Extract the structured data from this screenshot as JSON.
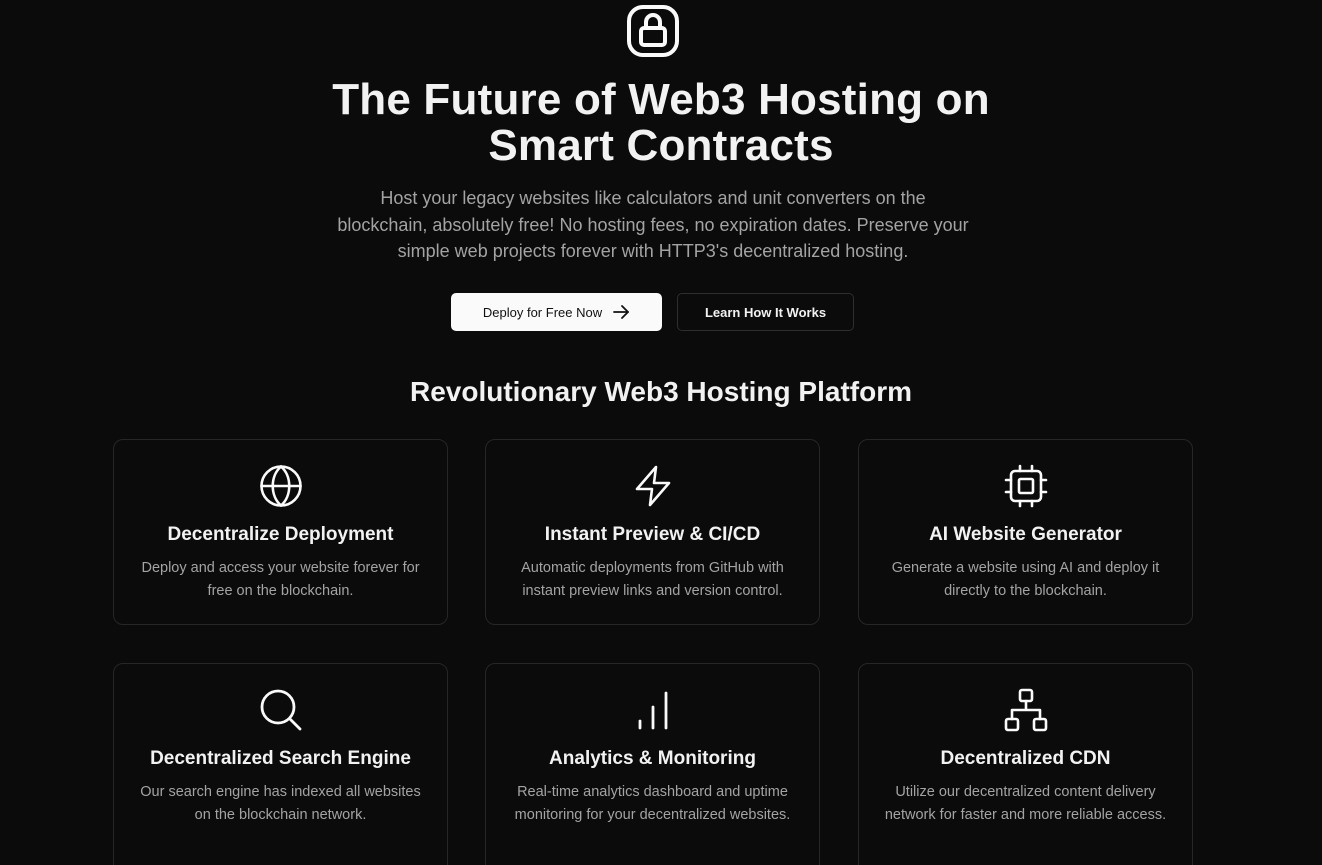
{
  "hero": {
    "icon": "lock-icon",
    "title_line1": "The Future of Web3 Hosting on",
    "title_line2": "Smart Contracts",
    "subtitle": "Host your legacy websites like calculators and unit converters on the blockchain, absolutely free! No hosting fees, no expiration dates. Preserve your simple web projects forever with HTTP3's decentralized hosting.",
    "primary_button": "Deploy for Free Now",
    "secondary_button": "Learn How It Works"
  },
  "features": {
    "section_title": "Revolutionary Web3 Hosting Platform",
    "items": [
      {
        "icon": "globe-icon",
        "title": "Decentralize Deployment",
        "description": "Deploy and access your website forever for free on the blockchain."
      },
      {
        "icon": "lightning-icon",
        "title": "Instant Preview & CI/CD",
        "description": "Automatic deployments from GitHub with instant preview links and version control."
      },
      {
        "icon": "cpu-chip-icon",
        "title": "AI Website Generator",
        "description": "Generate a website using AI and deploy it directly to the blockchain."
      },
      {
        "icon": "search-icon",
        "title": "Decentralized Search Engine",
        "description": "Our search engine has indexed all websites on the blockchain network."
      },
      {
        "icon": "bar-chart-icon",
        "title": "Analytics & Monitoring",
        "description": "Real-time analytics dashboard and uptime monitoring for your decentralized websites."
      },
      {
        "icon": "network-icon",
        "title": "Decentralized CDN",
        "description": "Utilize our decentralized content delivery network for faster and more reliable access."
      }
    ]
  },
  "colors": {
    "background": "#0b0b0b",
    "text": "#f2f2f2",
    "muted_text": "#a3a3a3",
    "border": "#262626",
    "primary_button_bg": "#fafafa"
  }
}
